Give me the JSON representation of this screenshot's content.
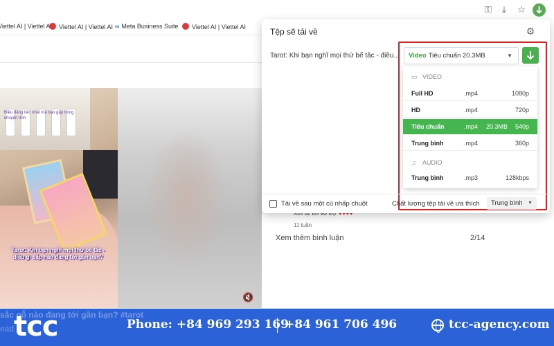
{
  "bookmarks": [
    {
      "label": "Viettel AI | Viettel AI"
    },
    {
      "label": "Viettel AI | Viettel AI"
    },
    {
      "label": "Meta Business Suite"
    },
    {
      "label": "Viettel AI | Viettel AI"
    }
  ],
  "toolbar": {
    "icons": [
      "key-icon",
      "download-manager-icon",
      "star-icon",
      "download-extension-icon"
    ]
  },
  "video": {
    "caption": "Tarot: Khi bạn nghĩ mọi thứ bế tắc - điều gì sắp nào đang tới gần bạn?",
    "shelf_text": "Điều đáng tiếc nhất mà bạn gặp trong chuyện tình",
    "mute_icon": "speaker-muted-icon"
  },
  "comments": {
    "partial_text": "Xin tự tin vô trợ",
    "hearts": "♥♥♥♥",
    "time": "11 tuần",
    "more_label": "Xem thêm bình luận",
    "count": "2/14"
  },
  "popup": {
    "title": "Tệp sẽ tải về",
    "item_title": "Tarot: Khi bạn nghĩ mọi thứ bế tắc - điều...",
    "selected": {
      "kind": "Video",
      "quality": "Tiêu chuẩn",
      "size": "20.3MB"
    },
    "menu": {
      "video_section": "VIDEO",
      "audio_section": "AUDIO",
      "video_options": [
        {
          "quality": "Full HD",
          "format": ".mp4",
          "size": "",
          "resolution": "1080p"
        },
        {
          "quality": "HD",
          "format": ".mp4",
          "size": "",
          "resolution": "720p"
        },
        {
          "quality": "Tiêu chuẩn",
          "format": ".mp4",
          "size": "20.3MB",
          "resolution": "540p"
        },
        {
          "quality": "Trung bình",
          "format": ".mp4",
          "size": "",
          "resolution": "360p"
        }
      ],
      "audio_options": [
        {
          "quality": "Trung bình",
          "format": ".mp3",
          "size": "",
          "resolution": "128kbps"
        }
      ],
      "selected_index": 2
    },
    "footer": {
      "checkbox_label": "Tải về sau một cú nhấp chuột",
      "checkbox_checked": false,
      "preference_label": "Chất lượng tệp tải về ưa thích",
      "preference_value": "Trung bình"
    }
  },
  "banner": {
    "logo": "tcc",
    "phone_1": "Phone: +84 969 293 169",
    "phone_2": "+84 961 706 496",
    "website": "tcc-agency.com",
    "background_text": "sắc gỗ nào đang tới gần bạn? #tarot",
    "background_text_2": "ead",
    "color": "#2c62d7"
  },
  "colors": {
    "accent_green": "#45b64f",
    "highlight_red": "#e02020"
  }
}
